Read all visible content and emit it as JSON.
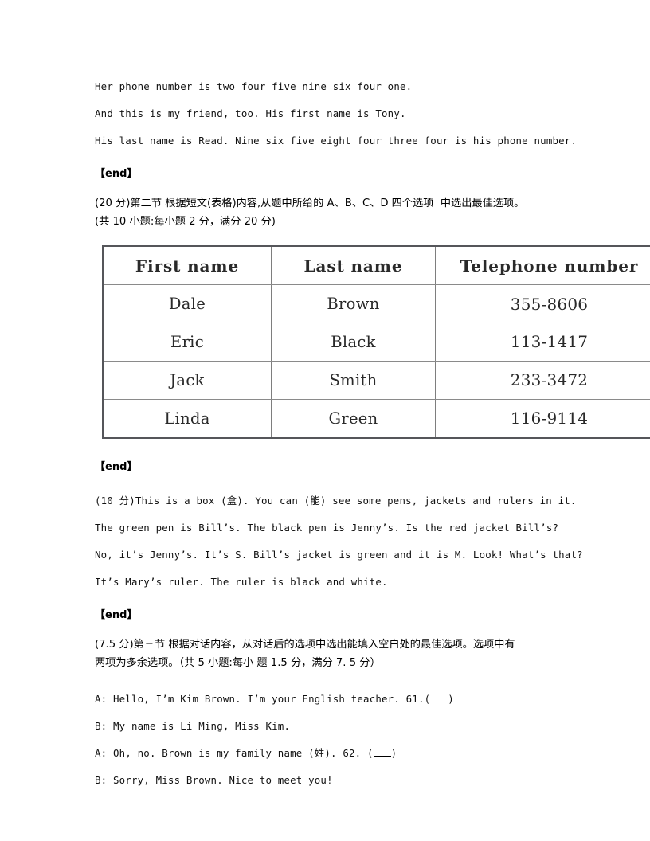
{
  "document": {
    "listening_passage": [
      "Her phone number is two four five nine six four one.",
      "And this is my friend, too. His first name is Tony.",
      "His last name is Read. Nine six five eight four three four is his phone number."
    ],
    "end_marker": "【end】",
    "section_two": {
      "line1": "(20 分)第二节 根据短文(表格)内容,从题中所给的 A、B、C、D 四个选项  中选出最佳选项。",
      "line2": "(共 10 小题:每小题 2 分，满分 20 分)"
    },
    "table": {
      "headers": [
        "First name",
        "Last name",
        "Telephone number"
      ],
      "rows": [
        [
          "Dale",
          "Brown",
          "355-8606"
        ],
        [
          "Eric",
          "Black",
          "113-1417"
        ],
        [
          "Jack",
          "Smith",
          "233-3472"
        ],
        [
          "Linda",
          "Green",
          "116-9114"
        ]
      ]
    },
    "box_passage": [
      "(10 分)This is a box (盒). You can (能) see some pens, jackets and rulers in it.",
      "The green pen is Bill’s. The black pen is Jenny’s. Is the red jacket Bill’s?",
      "No, it’s Jenny’s. It’s S. Bill’s jacket is green and it is M. Look! What’s that?",
      "It’s Mary’s ruler. The ruler is black and white."
    ],
    "section_three": {
      "line1": "(7.5 分)第三节 根据对话内容，从对话后的选项中选出能填入空白处的最佳选项。选项中有",
      "line2": "两项为多余选项。（共 5 小题:每小 题 1.5 分，满分 7. 5 分）"
    },
    "dialogue": [
      {
        "speaker_line": "A: Hello, I’m Kim Brown. I’m your English teacher. 61.(",
        "suffix": ")"
      },
      {
        "speaker_line": "B: My name is Li Ming, Miss Kim.",
        "suffix": ""
      },
      {
        "speaker_line": "A: Oh, no. Brown is my family name (姓). 62. (",
        "suffix": ")"
      },
      {
        "speaker_line": "B: Sorry, Miss Brown. Nice to meet you!",
        "suffix": ""
      }
    ]
  }
}
